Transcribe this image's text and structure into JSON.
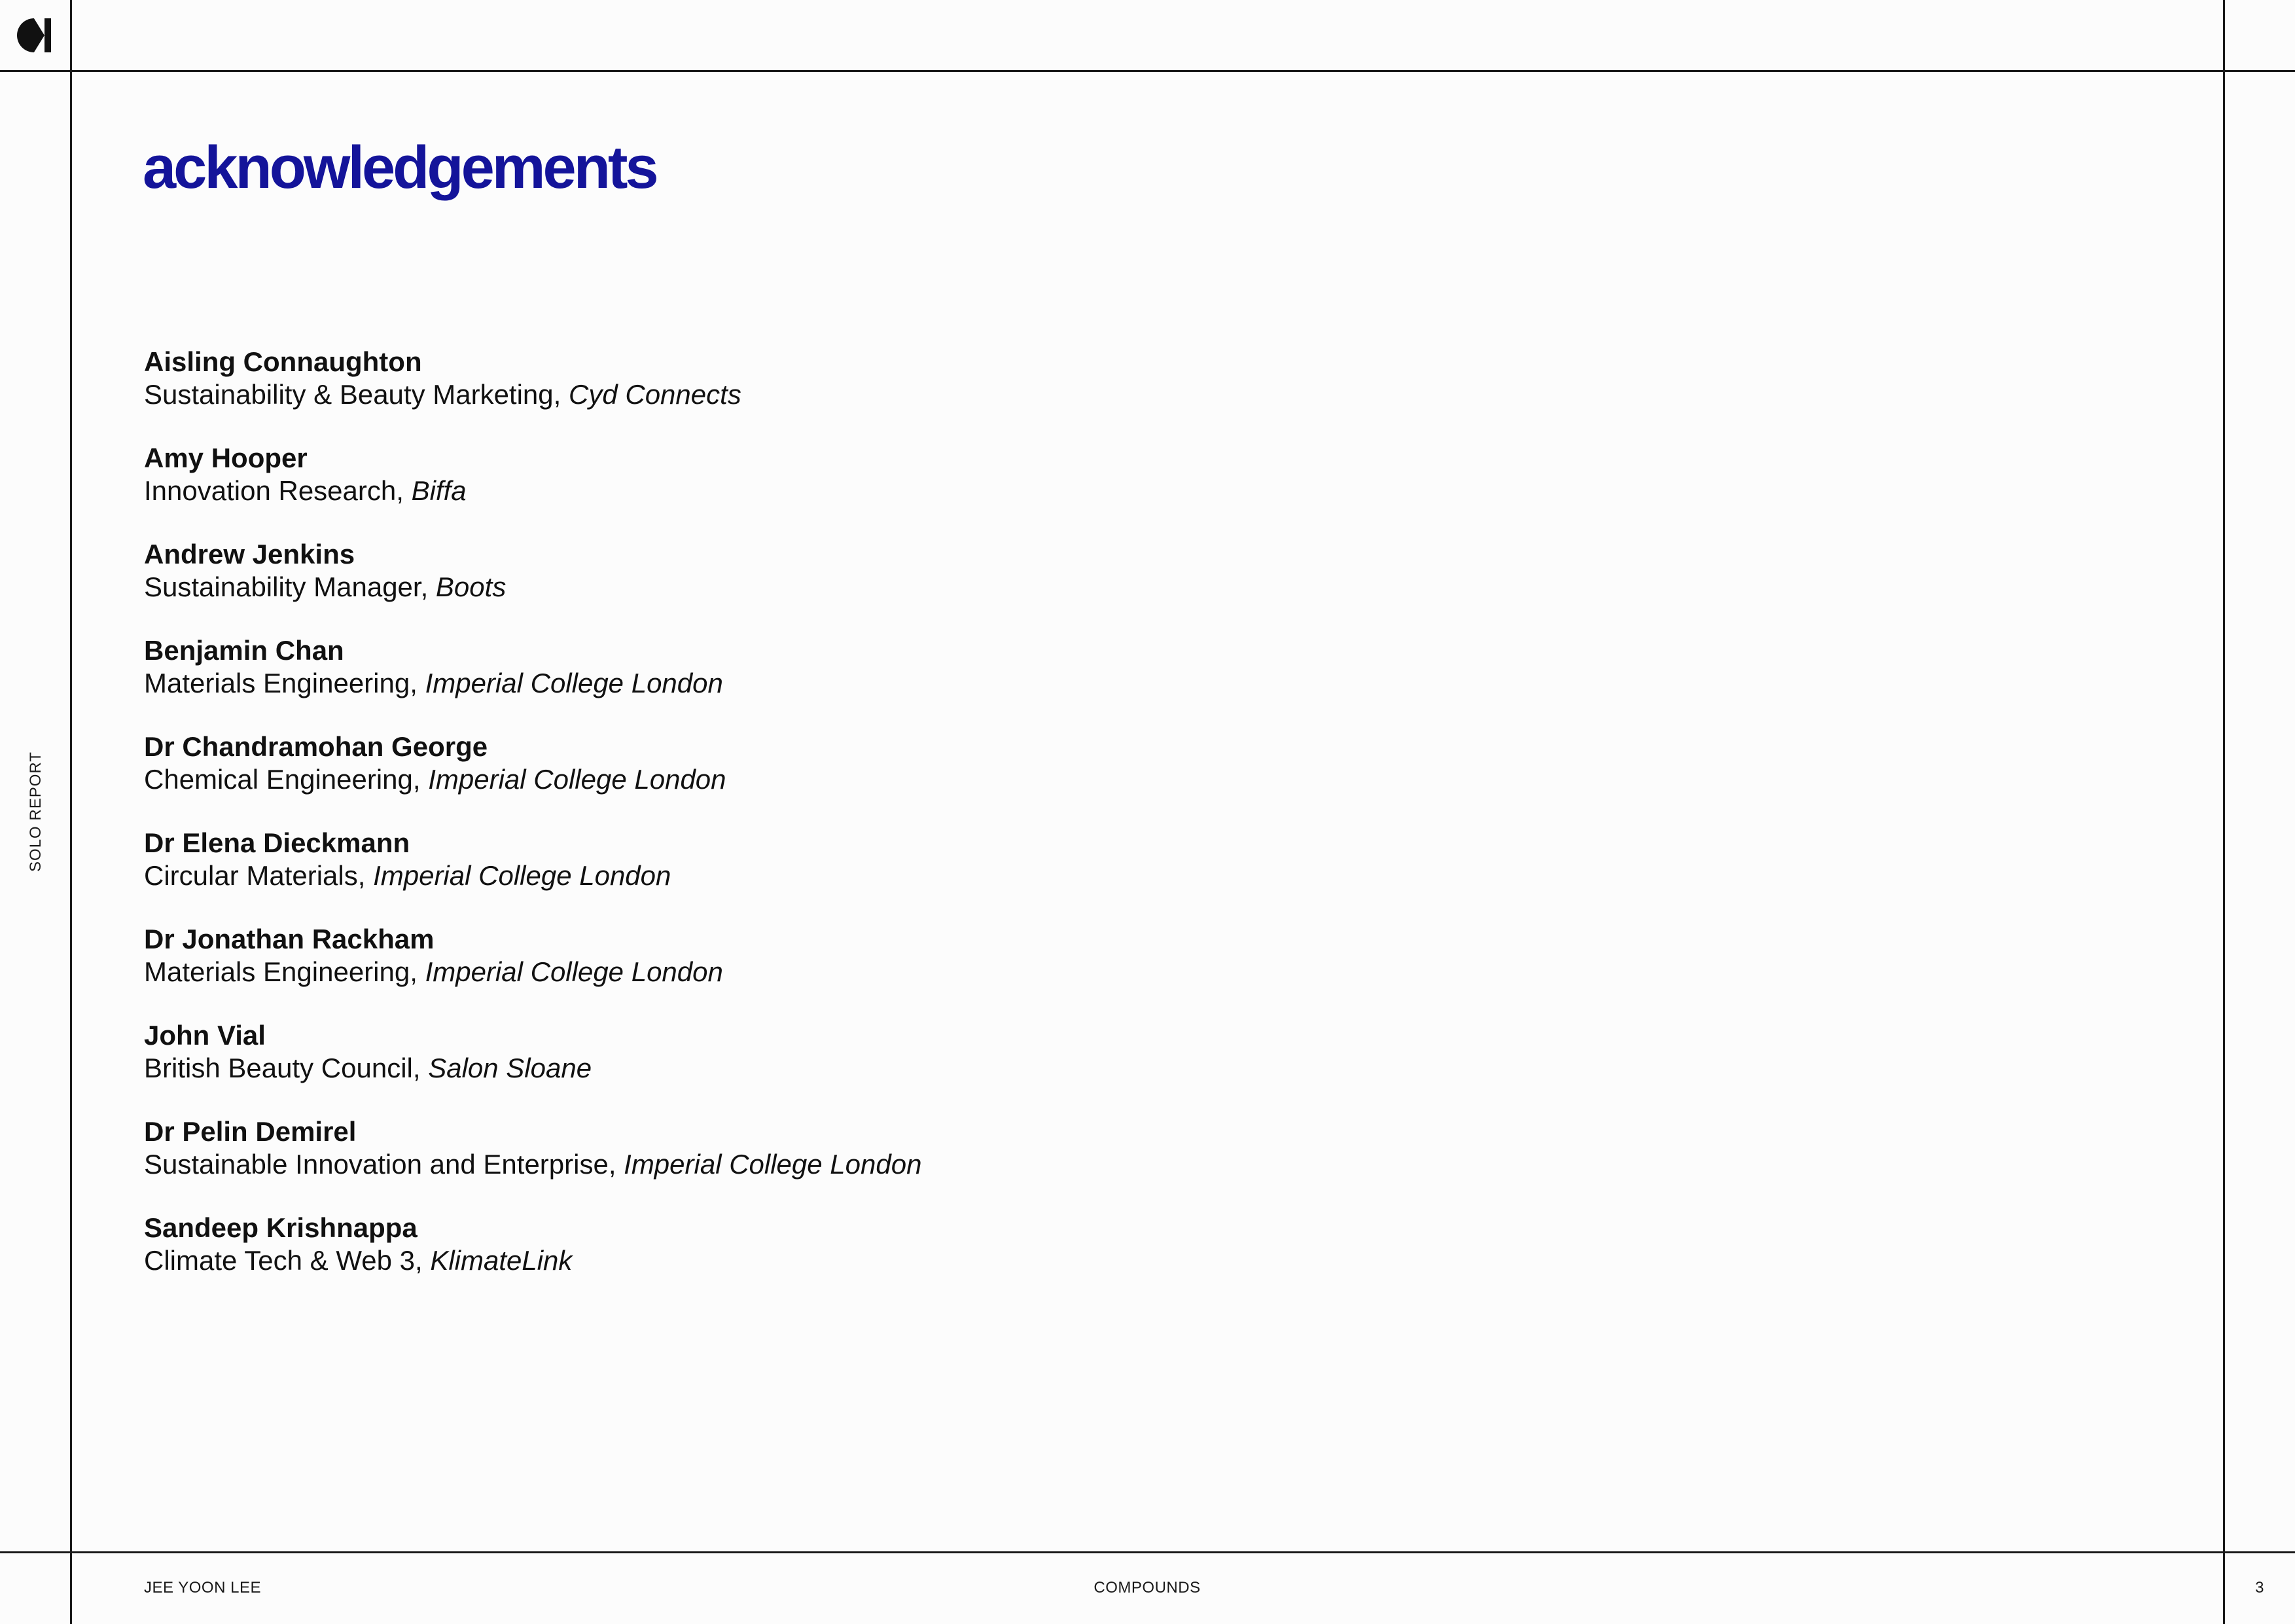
{
  "brand": {
    "logo_icon": "half-circle-notch-logo-icon",
    "accent_color": "#14149a"
  },
  "sidebar": {
    "label": "SOLO REPORT"
  },
  "page": {
    "title": "acknowledgements"
  },
  "acknowledgements": [
    {
      "name": "Aisling Connaughton",
      "role": "Sustainability & Beauty Marketing, ",
      "organization": "Cyd Connects"
    },
    {
      "name": "Amy Hooper",
      "role": "Innovation Research, ",
      "organization": "Biffa"
    },
    {
      "name": "Andrew Jenkins",
      "role": "Sustainability Manager, ",
      "organization": "Boots"
    },
    {
      "name": "Benjamin Chan",
      "role": "Materials Engineering, ",
      "organization": "Imperial College London"
    },
    {
      "name": "Dr Chandramohan George",
      "role": "Chemical Engineering, ",
      "organization": "Imperial College London"
    },
    {
      "name": "Dr Elena Dieckmann",
      "role": "Circular Materials, ",
      "organization": "Imperial College London"
    },
    {
      "name": "Dr Jonathan Rackham",
      "role": "Materials Engineering, ",
      "organization": "Imperial College London"
    },
    {
      "name": "John Vial",
      "role": "British Beauty Council, ",
      "organization": "Salon Sloane"
    },
    {
      "name": "Dr Pelin Demirel",
      "role": "Sustainable Innovation and Enterprise, ",
      "organization": "Imperial College London"
    },
    {
      "name": "Sandeep Krishnappa",
      "role": "Climate Tech & Web 3, ",
      "organization": "KlimateLink"
    }
  ],
  "footer": {
    "author": "JEE YOON LEE",
    "section": "COMPOUNDS",
    "page_number": "3"
  }
}
